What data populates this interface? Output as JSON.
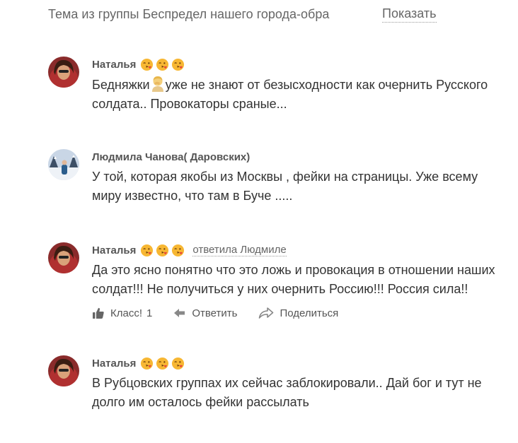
{
  "topic": {
    "text": "Тема из группы Беспредел нашего города-обра",
    "show_label": "Показать"
  },
  "comments": [
    {
      "author": "Наталья",
      "text_before": "Бедняжки",
      "inline_emoji": "person-facepalm-emoji",
      "text_after": "уже не знают от безысходности как очернить Русского солдата.. Провокаторы сраные...",
      "emojis": [
        "face-blowing-kiss-emoji",
        "face-blowing-kiss-emoji",
        "face-blowing-kiss-emoji"
      ]
    },
    {
      "author": "Людмила Чанова( Даровских)",
      "text": "У той, которая якобы из Москвы , фейки на страницы. Уже всему миру известно, что там в Буче ....."
    },
    {
      "author": "Наталья",
      "reply_to": "ответила Людмиле",
      "text": "Да это ясно понятно что это ложь и провокация в отношении наших солдат!!! Не получиться у них очернить Россию!!! Россия сила!!",
      "actions": {
        "like_label": "Класс!",
        "like_count": "1",
        "reply_label": "Ответить",
        "share_label": "Поделиться"
      }
    },
    {
      "author": "Наталья",
      "text": "В Рубцовских группах их сейчас заблокировали.. Дай бог и тут не долго им осталось фейки рассылать"
    }
  ],
  "colors": {
    "text": "#333333",
    "muted": "#666666",
    "emoji_face": "#f7b733",
    "emoji_heart": "#e8453c"
  }
}
